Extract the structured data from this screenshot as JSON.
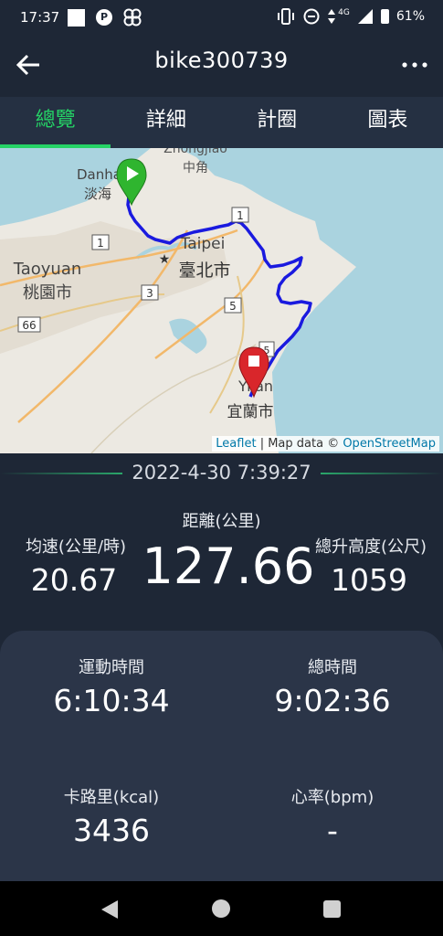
{
  "status_bar": {
    "time": "17:37",
    "network": "4G",
    "battery": "61%",
    "icons": [
      "notification-square-icon",
      "p-icon",
      "pinwheel-icon",
      "vibrate-icon",
      "dnd-icon",
      "data-arrows-icon",
      "signal-icon",
      "battery-icon"
    ]
  },
  "app_bar": {
    "title": "bike300739",
    "back_icon": "arrow-left-icon",
    "menu_icon": "more-horizontal-icon"
  },
  "tabs": [
    {
      "label": "總覽",
      "active": true
    },
    {
      "label": "詳細",
      "active": false
    },
    {
      "label": "計圈",
      "active": false
    },
    {
      "label": "圖表",
      "active": false
    }
  ],
  "map": {
    "labels": {
      "zhongjiao_en": "Zhongjiao",
      "zhongjiao_zh": "中角",
      "danshui_en": "Danha",
      "danshui_zh": "淡海",
      "taipei_en": "Taipei",
      "taipei_zh": "臺北市",
      "taoyuan_en": "Taoyuan",
      "taoyuan_zh": "桃園市",
      "yilan_en": "Yilan",
      "yilan_zh": "宜蘭市",
      "road_1a": "1",
      "road_1b": "1",
      "road_3": "3",
      "road_5": "5",
      "road_66": "66",
      "road_9": "5"
    },
    "start_marker": "start-pin-icon",
    "end_marker": "end-pin-icon",
    "attribution": {
      "leaflet": "Leaflet",
      "sep": " | Map data © ",
      "osm": "OpenStreetMap"
    },
    "colors": {
      "route": "#1a1adf",
      "sea": "#aad3df",
      "land": "#ece9e2",
      "start": "#2fb52f",
      "end": "#d9262b"
    }
  },
  "summary": {
    "datetime": "2022-4-30 7:39:27",
    "distance_label": "距離(公里)",
    "distance_value": "127.66",
    "avg_speed_label": "均速(公里/時)",
    "avg_speed_value": "20.67",
    "elevation_label": "總升高度(公尺)",
    "elevation_value": "1059"
  },
  "details": {
    "moving_time_label": "運動時間",
    "moving_time_value": "6:10:34",
    "total_time_label": "總時間",
    "total_time_value": "9:02:36",
    "calories_label": "卡路里(kcal)",
    "calories_value": "3436",
    "heart_rate_label": "心率(bpm)",
    "heart_rate_value": "-"
  },
  "nav_bar": {
    "icons": [
      "back-triangle-icon",
      "home-circle-icon",
      "recents-square-icon"
    ]
  },
  "colors": {
    "background": "#1e2736",
    "tab_bar": "#253042",
    "card": "#2b3548",
    "accent": "#25d366"
  }
}
